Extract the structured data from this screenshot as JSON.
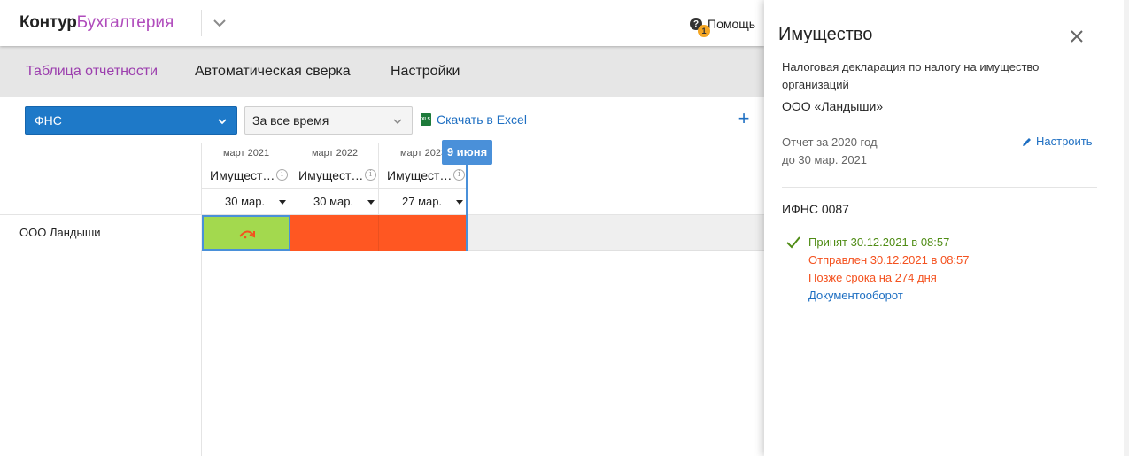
{
  "header": {
    "brand": "Контур",
    "product": "Бухгалтерия",
    "help_label": "Помощь",
    "help_badge": "1"
  },
  "nav": {
    "tabs": [
      {
        "label": "Таблица отчетности",
        "active": true
      },
      {
        "label": "Автоматическая сверка",
        "active": false
      },
      {
        "label": "Настройки",
        "active": false
      }
    ]
  },
  "toolbar": {
    "authority_select": "ФНС",
    "period_select": "За все время",
    "excel_link": "Скачать в Excel",
    "excel_icon_text": "XLS",
    "add_label": "+"
  },
  "table": {
    "columns": [
      {
        "period": "март 2021",
        "title": "Имущест…",
        "deadline": "30 мар."
      },
      {
        "period": "март 2022",
        "title": "Имущест…",
        "deadline": "30 мар."
      },
      {
        "period": "март 2023",
        "title": "Имущест…",
        "deadline": "27 мар."
      }
    ],
    "rows": [
      {
        "org": "ООО  Ландыши",
        "statuses": [
          "accepted",
          "overdue",
          "overdue"
        ]
      }
    ],
    "today_marker": "9 июня",
    "colors": {
      "accepted": "#a3d94e",
      "overdue": "#ff5722",
      "today": "#4a90d9"
    }
  },
  "panel": {
    "title": "Имущество",
    "description": "Налоговая декларация по налогу на имущество организаций",
    "organization": "ООО «Ландыши»",
    "report_period": "Отчет за 2020 год",
    "deadline": "до 30 мар. 2021",
    "configure_link": "Настроить",
    "inspection": "ИФНС 0087",
    "status": {
      "accepted": "Принят 30.12.2021 в 08:57",
      "sent": "Отправлен 30.12.2021 в 08:57",
      "late": "Позже срока на 274 дня",
      "docflow_link": "Документооборот"
    }
  }
}
